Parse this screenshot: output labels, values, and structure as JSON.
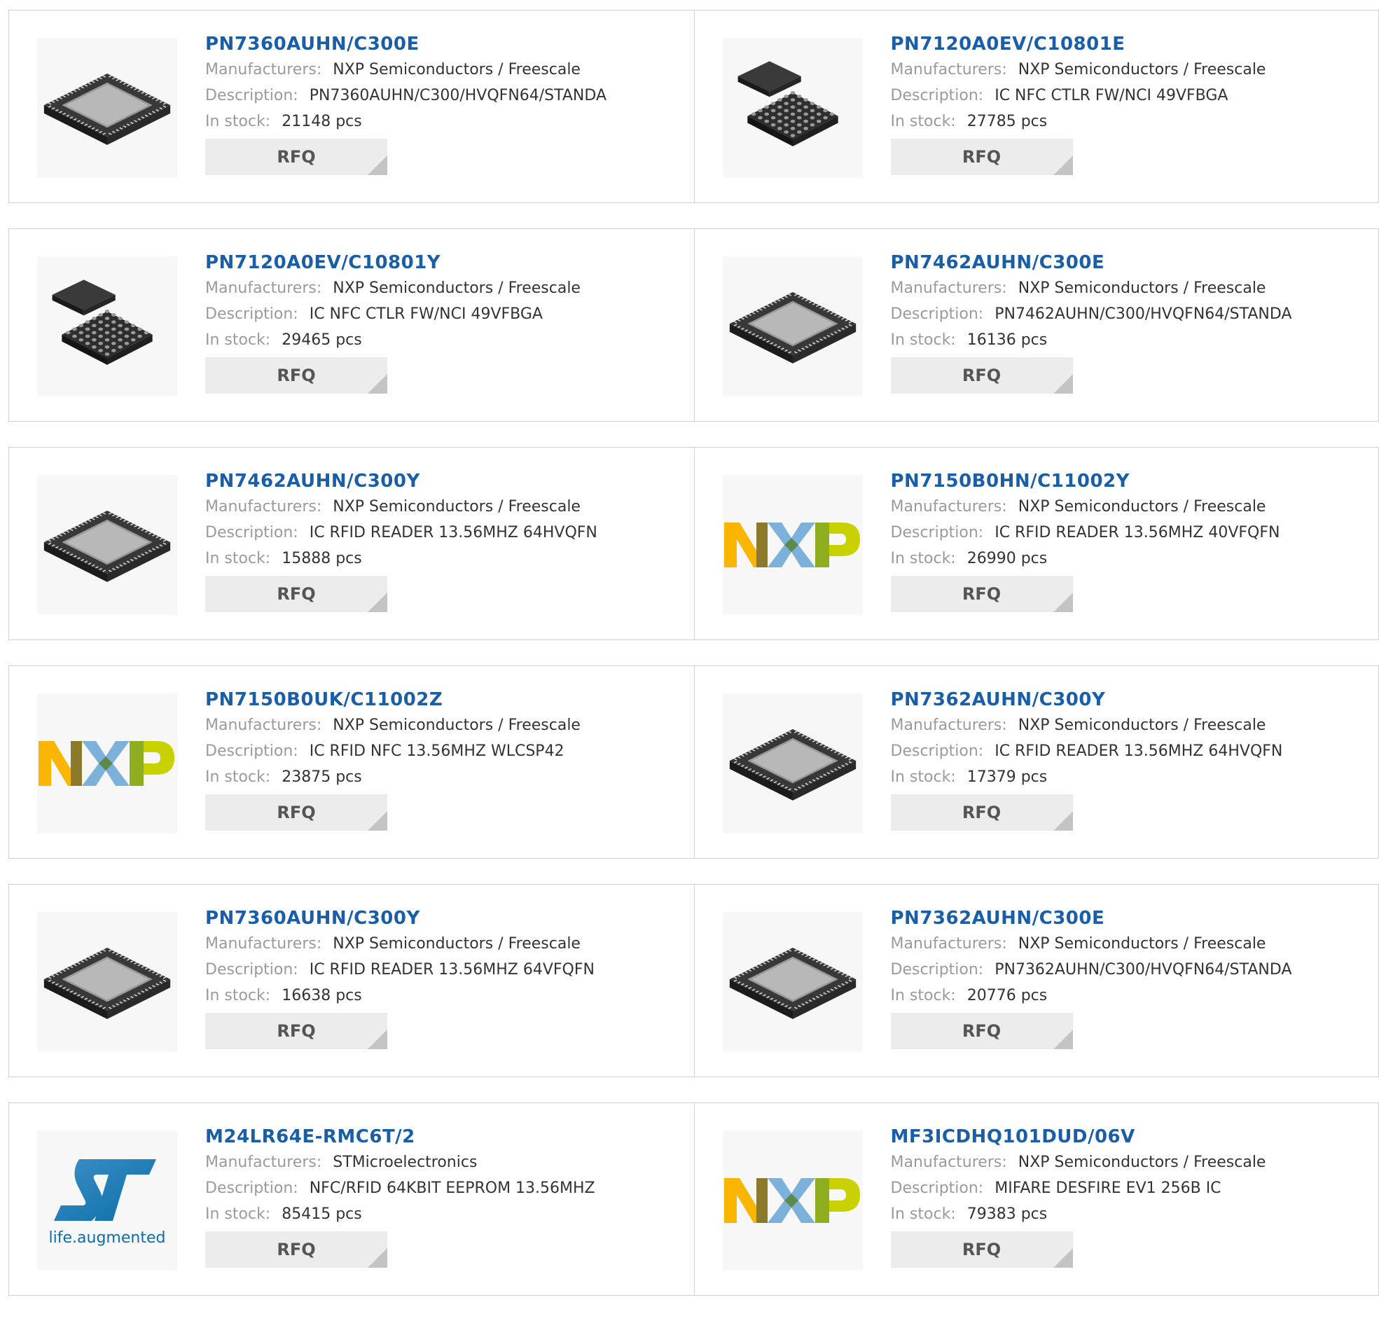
{
  "labels": {
    "manufacturers": "Manufacturers:",
    "description": "Description:",
    "in_stock": "In stock:",
    "rfq": "RFQ"
  },
  "products": [
    {
      "part": "PN7360AUHN/C300E",
      "manufacturer": "NXP Semiconductors / Freescale",
      "description": "PN7360AUHN/C300/HVQFN64/STANDA",
      "stock": "21148 pcs",
      "image": "qfn-chip-icon"
    },
    {
      "part": "PN7120A0EV/C10801E",
      "manufacturer": "NXP Semiconductors / Freescale",
      "description": "IC NFC CTLR FW/NCI 49VFBGA",
      "stock": "27785 pcs",
      "image": "bga-chip-icon"
    },
    {
      "part": "PN7120A0EV/C10801Y",
      "manufacturer": "NXP Semiconductors / Freescale",
      "description": "IC NFC CTLR FW/NCI 49VFBGA",
      "stock": "29465 pcs",
      "image": "bga-chip-icon"
    },
    {
      "part": "PN7462AUHN/C300E",
      "manufacturer": "NXP Semiconductors / Freescale",
      "description": "PN7462AUHN/C300/HVQFN64/STANDA",
      "stock": "16136 pcs",
      "image": "qfn-chip-icon"
    },
    {
      "part": "PN7462AUHN/C300Y",
      "manufacturer": "NXP Semiconductors / Freescale",
      "description": "IC RFID READER 13.56MHZ 64HVQFN",
      "stock": "15888 pcs",
      "image": "qfn-chip-icon"
    },
    {
      "part": "PN7150B0HN/C11002Y",
      "manufacturer": "NXP Semiconductors / Freescale",
      "description": "IC RFID READER 13.56MHZ 40VFQFN",
      "stock": "26990 pcs",
      "image": "nxp-logo"
    },
    {
      "part": "PN7150B0UK/C11002Z",
      "manufacturer": "NXP Semiconductors / Freescale",
      "description": "IC RFID NFC 13.56MHZ WLCSP42",
      "stock": "23875 pcs",
      "image": "nxp-logo"
    },
    {
      "part": "PN7362AUHN/C300Y",
      "manufacturer": "NXP Semiconductors / Freescale",
      "description": "IC RFID READER 13.56MHZ 64HVQFN",
      "stock": "17379 pcs",
      "image": "qfn-chip-icon"
    },
    {
      "part": "PN7360AUHN/C300Y",
      "manufacturer": "NXP Semiconductors / Freescale",
      "description": "IC RFID READER 13.56MHZ 64VFQFN",
      "stock": "16638 pcs",
      "image": "qfn-chip-icon"
    },
    {
      "part": "PN7362AUHN/C300E",
      "manufacturer": "NXP Semiconductors / Freescale",
      "description": "PN7362AUHN/C300/HVQFN64/STANDA",
      "stock": "20776 pcs",
      "image": "qfn-chip-icon"
    },
    {
      "part": "M24LR64E-RMC6T/2",
      "manufacturer": "STMicroelectronics",
      "description": "NFC/RFID 64KBIT EEPROM 13.56MHZ",
      "stock": "85415 pcs",
      "image": "st-logo"
    },
    {
      "part": "MF3ICDHQ101DUD/06V",
      "manufacturer": "NXP Semiconductors / Freescale",
      "description": "MIFARE DESFIRE EV1 256B IC",
      "stock": "79383 pcs",
      "image": "nxp-logo"
    }
  ],
  "logos": {
    "st_tagline": "life.augmented"
  },
  "colors": {
    "part_link": "#1a5ea8",
    "label": "#9a9a9a",
    "value": "#333333",
    "rfq_bg": "#ececec",
    "nxp_yellow": "#f9b500",
    "nxp_blue": "#7bb1db",
    "nxp_green": "#c9d200",
    "st_blue": "#0a6ea8"
  }
}
